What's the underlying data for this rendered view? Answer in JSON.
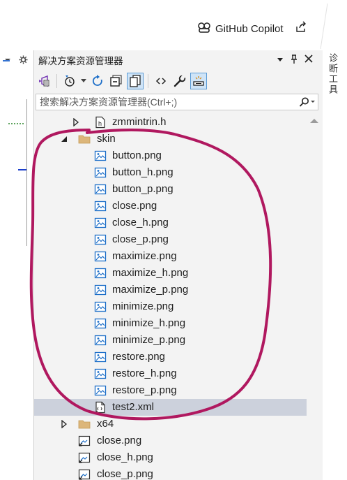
{
  "copilot": {
    "label": "GitHub Copilot"
  },
  "panel": {
    "title": "解决方案资源管理器",
    "search_placeholder": "搜索解决方案资源管理器(Ctrl+;)"
  },
  "side_tab": {
    "label": "诊断工具"
  },
  "tree": {
    "items": [
      {
        "label": "zmmintrin.h",
        "type": "header-file",
        "indent": 2,
        "expander": "collapsed"
      },
      {
        "label": "skin",
        "type": "folder",
        "indent": 1,
        "expander": "expanded"
      },
      {
        "label": "button.png",
        "type": "image",
        "indent": 2
      },
      {
        "label": "button_h.png",
        "type": "image",
        "indent": 2
      },
      {
        "label": "button_p.png",
        "type": "image",
        "indent": 2
      },
      {
        "label": "close.png",
        "type": "image",
        "indent": 2
      },
      {
        "label": "close_h.png",
        "type": "image",
        "indent": 2
      },
      {
        "label": "close_p.png",
        "type": "image",
        "indent": 2
      },
      {
        "label": "maximize.png",
        "type": "image",
        "indent": 2
      },
      {
        "label": "maximize_h.png",
        "type": "image",
        "indent": 2
      },
      {
        "label": "maximize_p.png",
        "type": "image",
        "indent": 2
      },
      {
        "label": "minimize.png",
        "type": "image",
        "indent": 2
      },
      {
        "label": "minimize_h.png",
        "type": "image",
        "indent": 2
      },
      {
        "label": "minimize_p.png",
        "type": "image",
        "indent": 2
      },
      {
        "label": "restore.png",
        "type": "image",
        "indent": 2
      },
      {
        "label": "restore_h.png",
        "type": "image",
        "indent": 2
      },
      {
        "label": "restore_p.png",
        "type": "image",
        "indent": 2
      },
      {
        "label": "test2.xml",
        "type": "xml",
        "indent": 2,
        "selected": true
      },
      {
        "label": "x64",
        "type": "folder",
        "indent": 1,
        "expander": "collapsed"
      },
      {
        "label": "close.png",
        "type": "image-ref",
        "indent": 1
      },
      {
        "label": "close_h.png",
        "type": "image-ref",
        "indent": 1
      },
      {
        "label": "close_p.png",
        "type": "image-ref",
        "indent": 1
      }
    ]
  },
  "colors": {
    "panel_bg": "#f3f3f3",
    "selection": "#ccd1dc",
    "annotation_stroke": "#b0185f",
    "folder": "#dcb67a",
    "accent_blue": "#1c6ec8"
  }
}
